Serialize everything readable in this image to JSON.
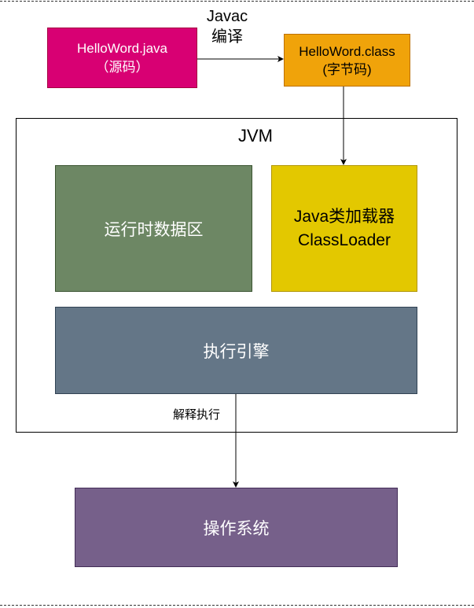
{
  "source": {
    "line1": "HelloWord.java",
    "line2": "（源码）",
    "color": "#d80073"
  },
  "compile": {
    "line1": "Javac",
    "line2": "编译"
  },
  "bytecode": {
    "line1": "HelloWord.class",
    "line2": "(字节码)",
    "color": "#f0a30a"
  },
  "jvm": {
    "title": "JVM",
    "runtime_data_area": {
      "label": "运行时数据区",
      "color": "#6d8764"
    },
    "class_loader": {
      "line1": "Java类加载器",
      "line2": "ClassLoader",
      "color": "#e3c800"
    },
    "execution_engine": {
      "label": "执行引擎",
      "color": "#647687"
    },
    "interpret_label": "解释执行"
  },
  "os": {
    "label": "操作系统",
    "color": "#76608a"
  }
}
